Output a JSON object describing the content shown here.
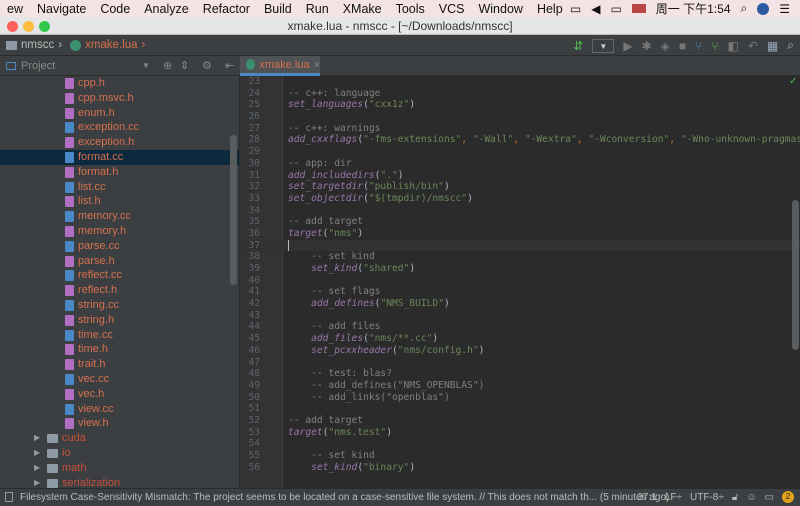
{
  "menubar": {
    "items": [
      "ew",
      "Navigate",
      "Code",
      "Analyze",
      "Refactor",
      "Build",
      "Run",
      "XMake",
      "Tools",
      "VCS",
      "Window",
      "Help"
    ],
    "clock": "周一 下午1:54"
  },
  "window": {
    "title": "xmake.lua - nmscc - [~/Downloads/nmscc]"
  },
  "navbar": {
    "project": "nmscc",
    "file": "xmake.lua"
  },
  "toolwindow": {
    "title": "Project"
  },
  "tab": {
    "label": "xmake.lua"
  },
  "tree": [
    {
      "name": "cpp.h",
      "type": "file"
    },
    {
      "name": "cpp.msvc.h",
      "type": "file"
    },
    {
      "name": "enum.h",
      "type": "file"
    },
    {
      "name": "exception.cc",
      "type": "file"
    },
    {
      "name": "exception.h",
      "type": "file"
    },
    {
      "name": "format.cc",
      "type": "file",
      "selected": true
    },
    {
      "name": "format.h",
      "type": "file"
    },
    {
      "name": "list.cc",
      "type": "file"
    },
    {
      "name": "list.h",
      "type": "file"
    },
    {
      "name": "memory.cc",
      "type": "file"
    },
    {
      "name": "memory.h",
      "type": "file"
    },
    {
      "name": "parse.cc",
      "type": "file"
    },
    {
      "name": "parse.h",
      "type": "file"
    },
    {
      "name": "reflect.cc",
      "type": "file"
    },
    {
      "name": "reflect.h",
      "type": "file"
    },
    {
      "name": "string.cc",
      "type": "file"
    },
    {
      "name": "string.h",
      "type": "file"
    },
    {
      "name": "time.cc",
      "type": "file"
    },
    {
      "name": "time.h",
      "type": "file"
    },
    {
      "name": "trait.h",
      "type": "file"
    },
    {
      "name": "vec.cc",
      "type": "file"
    },
    {
      "name": "vec.h",
      "type": "file"
    },
    {
      "name": "view.cc",
      "type": "file"
    },
    {
      "name": "view.h",
      "type": "file"
    },
    {
      "name": "cuda",
      "type": "folder"
    },
    {
      "name": "io",
      "type": "folder"
    },
    {
      "name": "math",
      "type": "folder"
    },
    {
      "name": "serialization",
      "type": "folder"
    }
  ],
  "code": [
    {
      "n": "23",
      "t": []
    },
    {
      "n": "24",
      "t": [
        [
          "c",
          "-- c++: language"
        ]
      ]
    },
    {
      "n": "25",
      "t": [
        [
          "f",
          "set_languages"
        ],
        [
          "p",
          "("
        ],
        [
          "s",
          "\"cxx1z\""
        ],
        [
          "p",
          ")"
        ]
      ]
    },
    {
      "n": "26",
      "t": []
    },
    {
      "n": "27",
      "t": [
        [
          "c",
          "-- c++: warnings"
        ]
      ]
    },
    {
      "n": "28",
      "t": [
        [
          "f",
          "add_cxxflags"
        ],
        [
          "p",
          "("
        ],
        [
          "s",
          "\"-fms-extensions\""
        ],
        [
          "k",
          ", "
        ],
        [
          "s",
          "\"-Wall\""
        ],
        [
          "k",
          ", "
        ],
        [
          "s",
          "\"-Wextra\""
        ],
        [
          "k",
          ", "
        ],
        [
          "s",
          "\"-Wconversion\""
        ],
        [
          "k",
          ", "
        ],
        [
          "s",
          "\"-Wno-unknown-pragmas\""
        ],
        [
          "p",
          ")"
        ]
      ]
    },
    {
      "n": "29",
      "t": []
    },
    {
      "n": "30",
      "t": [
        [
          "c",
          "-- app: dir"
        ]
      ]
    },
    {
      "n": "31",
      "t": [
        [
          "f",
          "add_includedirs"
        ],
        [
          "p",
          "("
        ],
        [
          "s",
          "\".\""
        ],
        [
          "p",
          ")"
        ]
      ]
    },
    {
      "n": "32",
      "t": [
        [
          "f",
          "set_targetdir"
        ],
        [
          "p",
          "("
        ],
        [
          "s",
          "\"publish/bin\""
        ],
        [
          "p",
          ")"
        ]
      ]
    },
    {
      "n": "33",
      "t": [
        [
          "f",
          "set_objectdir"
        ],
        [
          "p",
          "("
        ],
        [
          "s",
          "\"$(tmpdir)/nmscc\""
        ],
        [
          "p",
          ")"
        ]
      ]
    },
    {
      "n": "34",
      "t": []
    },
    {
      "n": "35",
      "t": [
        [
          "c",
          "-- add target"
        ]
      ]
    },
    {
      "n": "36",
      "t": [
        [
          "f",
          "target"
        ],
        [
          "p",
          "("
        ],
        [
          "s",
          "\"nms\""
        ],
        [
          "p",
          ")"
        ]
      ]
    },
    {
      "n": "37",
      "t": [],
      "cur": true
    },
    {
      "n": "38",
      "t": [
        [
          "c",
          "    -- set kind"
        ]
      ]
    },
    {
      "n": "39",
      "t": [
        [
          "p",
          "    "
        ],
        [
          "f",
          "set_kind"
        ],
        [
          "p",
          "("
        ],
        [
          "s",
          "\"shared\""
        ],
        [
          "p",
          ")"
        ]
      ]
    },
    {
      "n": "40",
      "t": []
    },
    {
      "n": "41",
      "t": [
        [
          "c",
          "    -- set flags"
        ]
      ]
    },
    {
      "n": "42",
      "t": [
        [
          "p",
          "    "
        ],
        [
          "f",
          "add_defines"
        ],
        [
          "p",
          "("
        ],
        [
          "s",
          "\"NMS_BUILD\""
        ],
        [
          "p",
          ")"
        ]
      ]
    },
    {
      "n": "43",
      "t": []
    },
    {
      "n": "44",
      "t": [
        [
          "c",
          "    -- add files"
        ]
      ]
    },
    {
      "n": "45",
      "t": [
        [
          "p",
          "    "
        ],
        [
          "f",
          "add_files"
        ],
        [
          "p",
          "("
        ],
        [
          "s",
          "\"nms/**.cc\""
        ],
        [
          "p",
          ")"
        ]
      ]
    },
    {
      "n": "46",
      "t": [
        [
          "p",
          "    "
        ],
        [
          "f",
          "set_pcxxheader"
        ],
        [
          "p",
          "("
        ],
        [
          "s",
          "\"nms/config.h\""
        ],
        [
          "p",
          ")"
        ]
      ]
    },
    {
      "n": "47",
      "t": []
    },
    {
      "n": "48",
      "t": [
        [
          "c",
          "    -- test: blas?"
        ]
      ]
    },
    {
      "n": "49",
      "t": [
        [
          "c",
          "    -- add_defines(\"NMS_OPENBLAS\")"
        ]
      ]
    },
    {
      "n": "50",
      "t": [
        [
          "c",
          "    -- add_links(\"openblas\")"
        ]
      ]
    },
    {
      "n": "51",
      "t": []
    },
    {
      "n": "52",
      "t": [
        [
          "c",
          "-- add target"
        ]
      ]
    },
    {
      "n": "53",
      "t": [
        [
          "f",
          "target"
        ],
        [
          "p",
          "("
        ],
        [
          "s",
          "\"nms.test\""
        ],
        [
          "p",
          ")"
        ]
      ]
    },
    {
      "n": "54",
      "t": []
    },
    {
      "n": "55",
      "t": [
        [
          "c",
          "    -- set kind"
        ]
      ]
    },
    {
      "n": "56",
      "t": [
        [
          "p",
          "    "
        ],
        [
          "f",
          "set_kind"
        ],
        [
          "p",
          "("
        ],
        [
          "s",
          "\"binary\""
        ],
        [
          "p",
          ")"
        ]
      ]
    }
  ],
  "status": {
    "message": "Filesystem Case-Sensitivity Mismatch: The project seems to be located on a case-sensitive file system. // This does not match th... (5 minutes ago)",
    "position": "37:1",
    "line_sep": "LF÷",
    "encoding": "UTF-8÷",
    "notifications": "2"
  }
}
